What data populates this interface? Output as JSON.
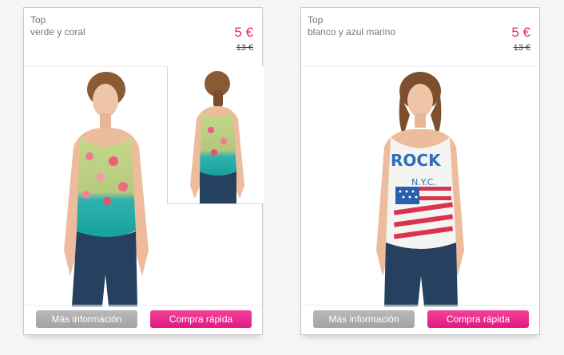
{
  "products": [
    {
      "category": "Top",
      "color_name": "verde y coral",
      "price": "5 €",
      "old_price": "13 €",
      "more_info_label": "Más información",
      "quick_buy_label": "Compra rápida"
    },
    {
      "category": "Top",
      "color_name": "blanco y azul marino",
      "price": "5 €",
      "old_price": "13 €",
      "more_info_label": "Más información",
      "quick_buy_label": "Compra rápida"
    }
  ],
  "colors": {
    "accent": "#e5267b",
    "info_button": "#a9a9a9",
    "buy_button": "#e91e87",
    "page_background": "#f6f5f6"
  }
}
